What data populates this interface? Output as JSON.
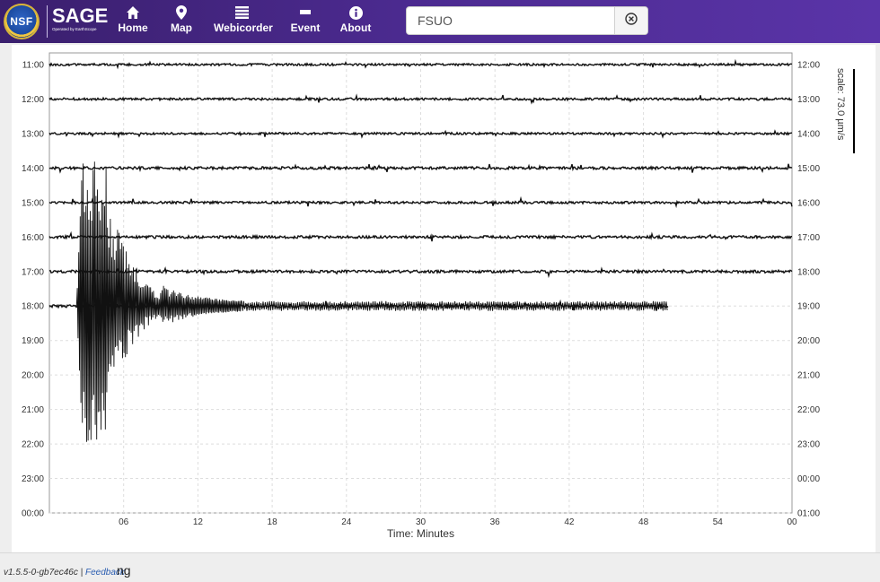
{
  "header": {
    "logo_text": "NSF",
    "brand_name": "SAGE",
    "brand_sub": "Operated by EarthScope",
    "nav": [
      {
        "label": "Home",
        "icon": "home-icon"
      },
      {
        "label": "Map",
        "icon": "map-pin-icon"
      },
      {
        "label": "Webicorder",
        "icon": "list-icon"
      },
      {
        "label": "Event",
        "icon": "minus-icon"
      },
      {
        "label": "About",
        "icon": "info-icon"
      }
    ],
    "search": {
      "value": "FSUO",
      "clear_icon": "clear-circle-icon"
    }
  },
  "chart_data": {
    "type": "line",
    "xlabel": "Time: Minutes",
    "xlim": [
      0,
      60
    ],
    "x_ticks": [
      "06",
      "12",
      "18",
      "24",
      "30",
      "36",
      "42",
      "48",
      "54",
      "00"
    ],
    "left_labels": [
      "11:00",
      "12:00",
      "13:00",
      "14:00",
      "15:00",
      "16:00",
      "17:00",
      "18:00",
      "19:00",
      "20:00",
      "21:00",
      "22:00",
      "23:00",
      "00:00"
    ],
    "right_labels": [
      "12:00",
      "13:00",
      "14:00",
      "15:00",
      "16:00",
      "17:00",
      "18:00",
      "19:00",
      "20:00",
      "21:00",
      "22:00",
      "23:00",
      "00:00",
      "01:00"
    ],
    "scale_label": "scale: 73.0 µm/s",
    "grid": true,
    "traces": [
      {
        "row": 0,
        "end_min": 60,
        "noise": 1.2
      },
      {
        "row": 1,
        "end_min": 60,
        "noise": 1.3
      },
      {
        "row": 2,
        "end_min": 60,
        "noise": 1.2
      },
      {
        "row": 3,
        "end_min": 60,
        "noise": 1.5
      },
      {
        "row": 4,
        "end_min": 60,
        "noise": 1.3
      },
      {
        "row": 5,
        "end_min": 60,
        "noise": 1.5
      },
      {
        "row": 6,
        "end_min": 60,
        "noise": 1.5
      },
      {
        "row": 7,
        "end_min": 50,
        "noise": 1.6
      }
    ],
    "event": {
      "row": 7,
      "start_min": 2.2,
      "peak_min": 3.6,
      "decay_min": 9
    }
  },
  "footer": {
    "version": "v1.5.5-0-gb7ec46c",
    "separator": "|",
    "feedback": "Feedback",
    "trail": "ng"
  },
  "colors": {
    "header": "#4b2a8f",
    "trace": "#111111",
    "grid": "#dddddd"
  }
}
